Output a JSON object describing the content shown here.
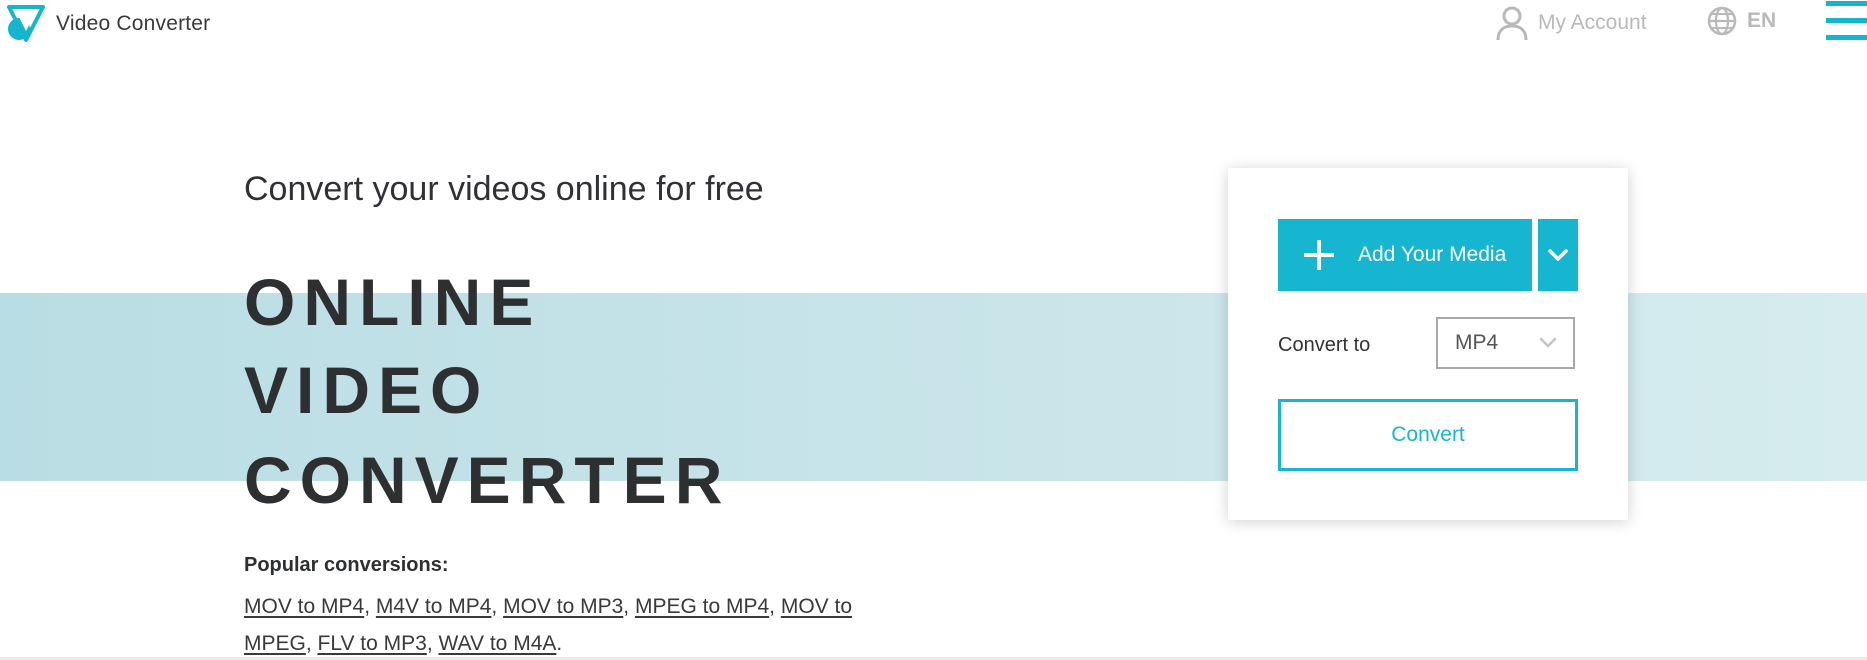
{
  "header": {
    "app_name": "Video Converter",
    "account_label": "My Account",
    "language_label": "EN"
  },
  "hero": {
    "subtitle": "Convert your videos online for free",
    "title_lines": [
      "ONLINE",
      "VIDEO",
      "CONVERTER"
    ]
  },
  "popular": {
    "label": "Popular conversions:",
    "links": [
      "MOV to MP4",
      "M4V to MP4",
      "MOV to MP3",
      "MPEG to MP4",
      "MOV to MPEG",
      "FLV to MP3",
      "WAV to M4A"
    ]
  },
  "converter": {
    "add_media_label": "Add Your Media",
    "convert_to_label": "Convert to",
    "format_selected": "MP4",
    "convert_button_label": "Convert"
  },
  "colors": {
    "accent": "#16b6d0",
    "band": "#c9e5ea",
    "muted_text": "#b9b9b9"
  },
  "icons": {
    "logo": "video-converter-logo-icon",
    "account": "user-icon",
    "language": "globe-icon",
    "menu": "hamburger-menu-icon",
    "add": "plus-icon",
    "dropdown": "chevron-down-icon"
  }
}
